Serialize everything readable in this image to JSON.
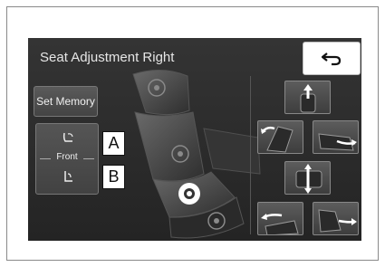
{
  "header": {
    "title": "Seat Adjustment Right"
  },
  "left_panel": {
    "set_memory_label": "Set Memory",
    "front_label": "Front"
  },
  "callouts": {
    "a": "A",
    "b": "B"
  },
  "icons": {
    "back": "back-arrow-icon",
    "headrest_up": "headrest-up-icon",
    "backrest_recline": "backrest-recline-icon",
    "cushion_slide": "cushion-slide-icon",
    "height": "seat-height-icon",
    "backrest_forward": "backrest-forward-icon",
    "legrest": "legrest-icon"
  },
  "colors": {
    "screen_bg": "#2b2b2b",
    "accent": "#ffffff"
  }
}
